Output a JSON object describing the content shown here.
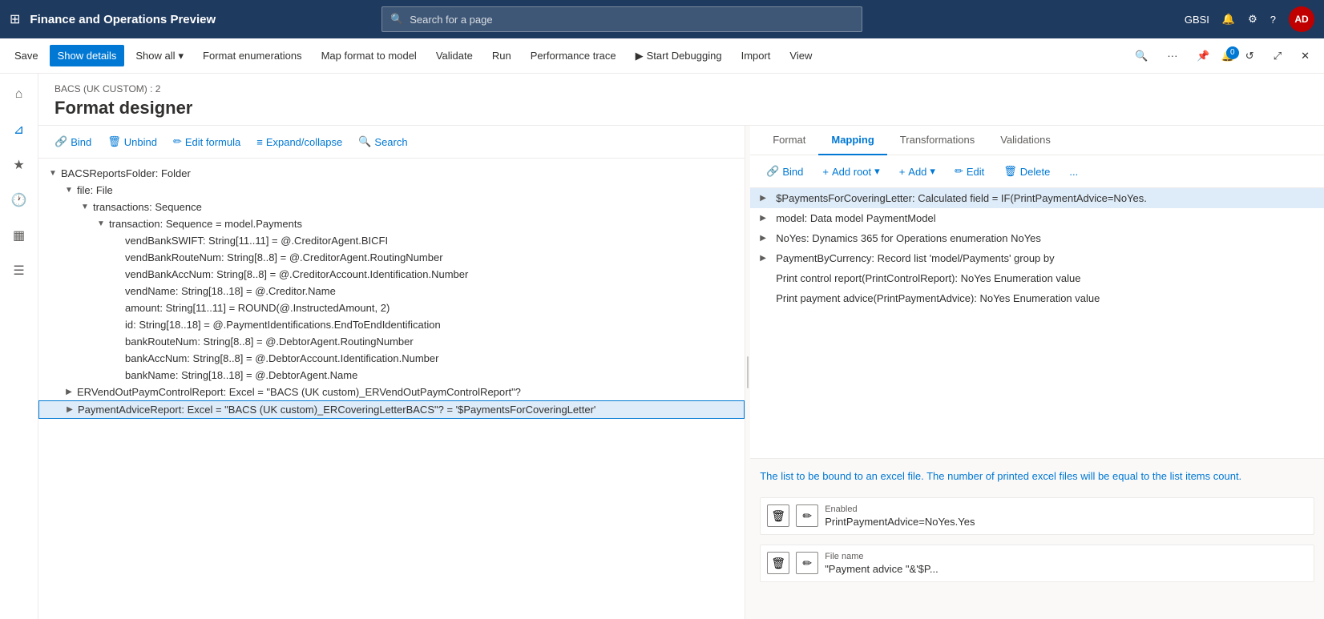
{
  "topbar": {
    "title": "Finance and Operations Preview",
    "search_placeholder": "Search for a page",
    "user_initials": "AD",
    "user_code": "GBSI"
  },
  "commandbar": {
    "save": "Save",
    "show_details": "Show details",
    "show_all": "Show all",
    "format_enumerations": "Format enumerations",
    "map_format_to_model": "Map format to model",
    "validate": "Validate",
    "run": "Run",
    "performance_trace": "Performance trace",
    "start_debugging": "Start Debugging",
    "import": "Import",
    "view": "View"
  },
  "page": {
    "breadcrumb": "BACS (UK CUSTOM) : 2",
    "title": "Format designer"
  },
  "format_toolbar": {
    "bind": "Bind",
    "unbind": "Unbind",
    "edit_formula": "Edit formula",
    "expand_collapse": "Expand/collapse",
    "search": "Search"
  },
  "tree": {
    "items": [
      {
        "id": 1,
        "indent": 1,
        "toggle": "▼",
        "text": "BACSReportsFolder: Folder",
        "selected": false
      },
      {
        "id": 2,
        "indent": 2,
        "toggle": "▼",
        "text": "file: File",
        "selected": false
      },
      {
        "id": 3,
        "indent": 3,
        "toggle": "▼",
        "text": "transactions: Sequence",
        "selected": false
      },
      {
        "id": 4,
        "indent": 4,
        "toggle": "▼",
        "text": "transaction: Sequence = model.Payments",
        "selected": false
      },
      {
        "id": 5,
        "indent": 5,
        "toggle": "",
        "text": "vendBankSWIFT: String[11..11] = @.CreditorAgent.BICFI",
        "selected": false
      },
      {
        "id": 6,
        "indent": 5,
        "toggle": "",
        "text": "vendBankRouteNum: String[8..8] = @.CreditorAgent.RoutingNumber",
        "selected": false
      },
      {
        "id": 7,
        "indent": 5,
        "toggle": "",
        "text": "vendBankAccNum: String[8..8] = @.CreditorAccount.Identification.Number",
        "selected": false
      },
      {
        "id": 8,
        "indent": 5,
        "toggle": "",
        "text": "vendName: String[18..18] = @.Creditor.Name",
        "selected": false
      },
      {
        "id": 9,
        "indent": 5,
        "toggle": "",
        "text": "amount: String[11..11] = ROUND(@.InstructedAmount, 2)",
        "selected": false
      },
      {
        "id": 10,
        "indent": 5,
        "toggle": "",
        "text": "id: String[18..18] = @.PaymentIdentifications.EndToEndIdentification",
        "selected": false
      },
      {
        "id": 11,
        "indent": 5,
        "toggle": "",
        "text": "bankRouteNum: String[8..8] = @.DebtorAgent.RoutingNumber",
        "selected": false
      },
      {
        "id": 12,
        "indent": 5,
        "toggle": "",
        "text": "bankAccNum: String[8..8] = @.DebtorAccount.Identification.Number",
        "selected": false
      },
      {
        "id": 13,
        "indent": 5,
        "toggle": "",
        "text": "bankName: String[18..18] = @.DebtorAgent.Name",
        "selected": false
      },
      {
        "id": 14,
        "indent": 2,
        "toggle": "▶",
        "text": "ERVendOutPaymControlReport: Excel = \"BACS (UK custom)_ERVendOutPaymControlReport\"?",
        "selected": false
      },
      {
        "id": 15,
        "indent": 2,
        "toggle": "▶",
        "text": "PaymentAdviceReport: Excel = \"BACS (UK custom)_ERCoveringLetterBACS\"? = '$PaymentsForCoveringLetter'",
        "selected": true,
        "highlighted": true
      }
    ]
  },
  "mapping": {
    "tabs": [
      "Format",
      "Mapping",
      "Transformations",
      "Validations"
    ],
    "active_tab": "Mapping",
    "toolbar": {
      "bind": "Bind",
      "add_root": "Add root",
      "add": "Add",
      "edit": "Edit",
      "delete": "Delete",
      "more": "..."
    },
    "items": [
      {
        "id": 1,
        "indent": 0,
        "toggle": "▶",
        "text": "$PaymentsForCoveringLetter: Calculated field = IF(PrintPaymentAdvice=NoYes.",
        "selected": true
      },
      {
        "id": 2,
        "indent": 0,
        "toggle": "▶",
        "text": "model: Data model PaymentModel",
        "selected": false
      },
      {
        "id": 3,
        "indent": 0,
        "toggle": "▶",
        "text": "NoYes: Dynamics 365 for Operations enumeration NoYes",
        "selected": false
      },
      {
        "id": 4,
        "indent": 0,
        "toggle": "▶",
        "text": "PaymentByCurrency: Record list 'model/Payments' group by",
        "selected": false
      },
      {
        "id": 5,
        "indent": 0,
        "toggle": "",
        "text": "Print control report(PrintControlReport): NoYes Enumeration value",
        "selected": false
      },
      {
        "id": 6,
        "indent": 0,
        "toggle": "",
        "text": "Print payment advice(PrintPaymentAdvice): NoYes Enumeration value",
        "selected": false
      }
    ],
    "info": {
      "description": "The list to be bound to an excel file. The number of printed excel files will be equal to the list items count.",
      "enabled_label": "Enabled",
      "enabled_value": "PrintPaymentAdvice=NoYes.Yes",
      "filename_label": "File name",
      "filename_value": "\"Payment advice \"&'$P..."
    }
  }
}
